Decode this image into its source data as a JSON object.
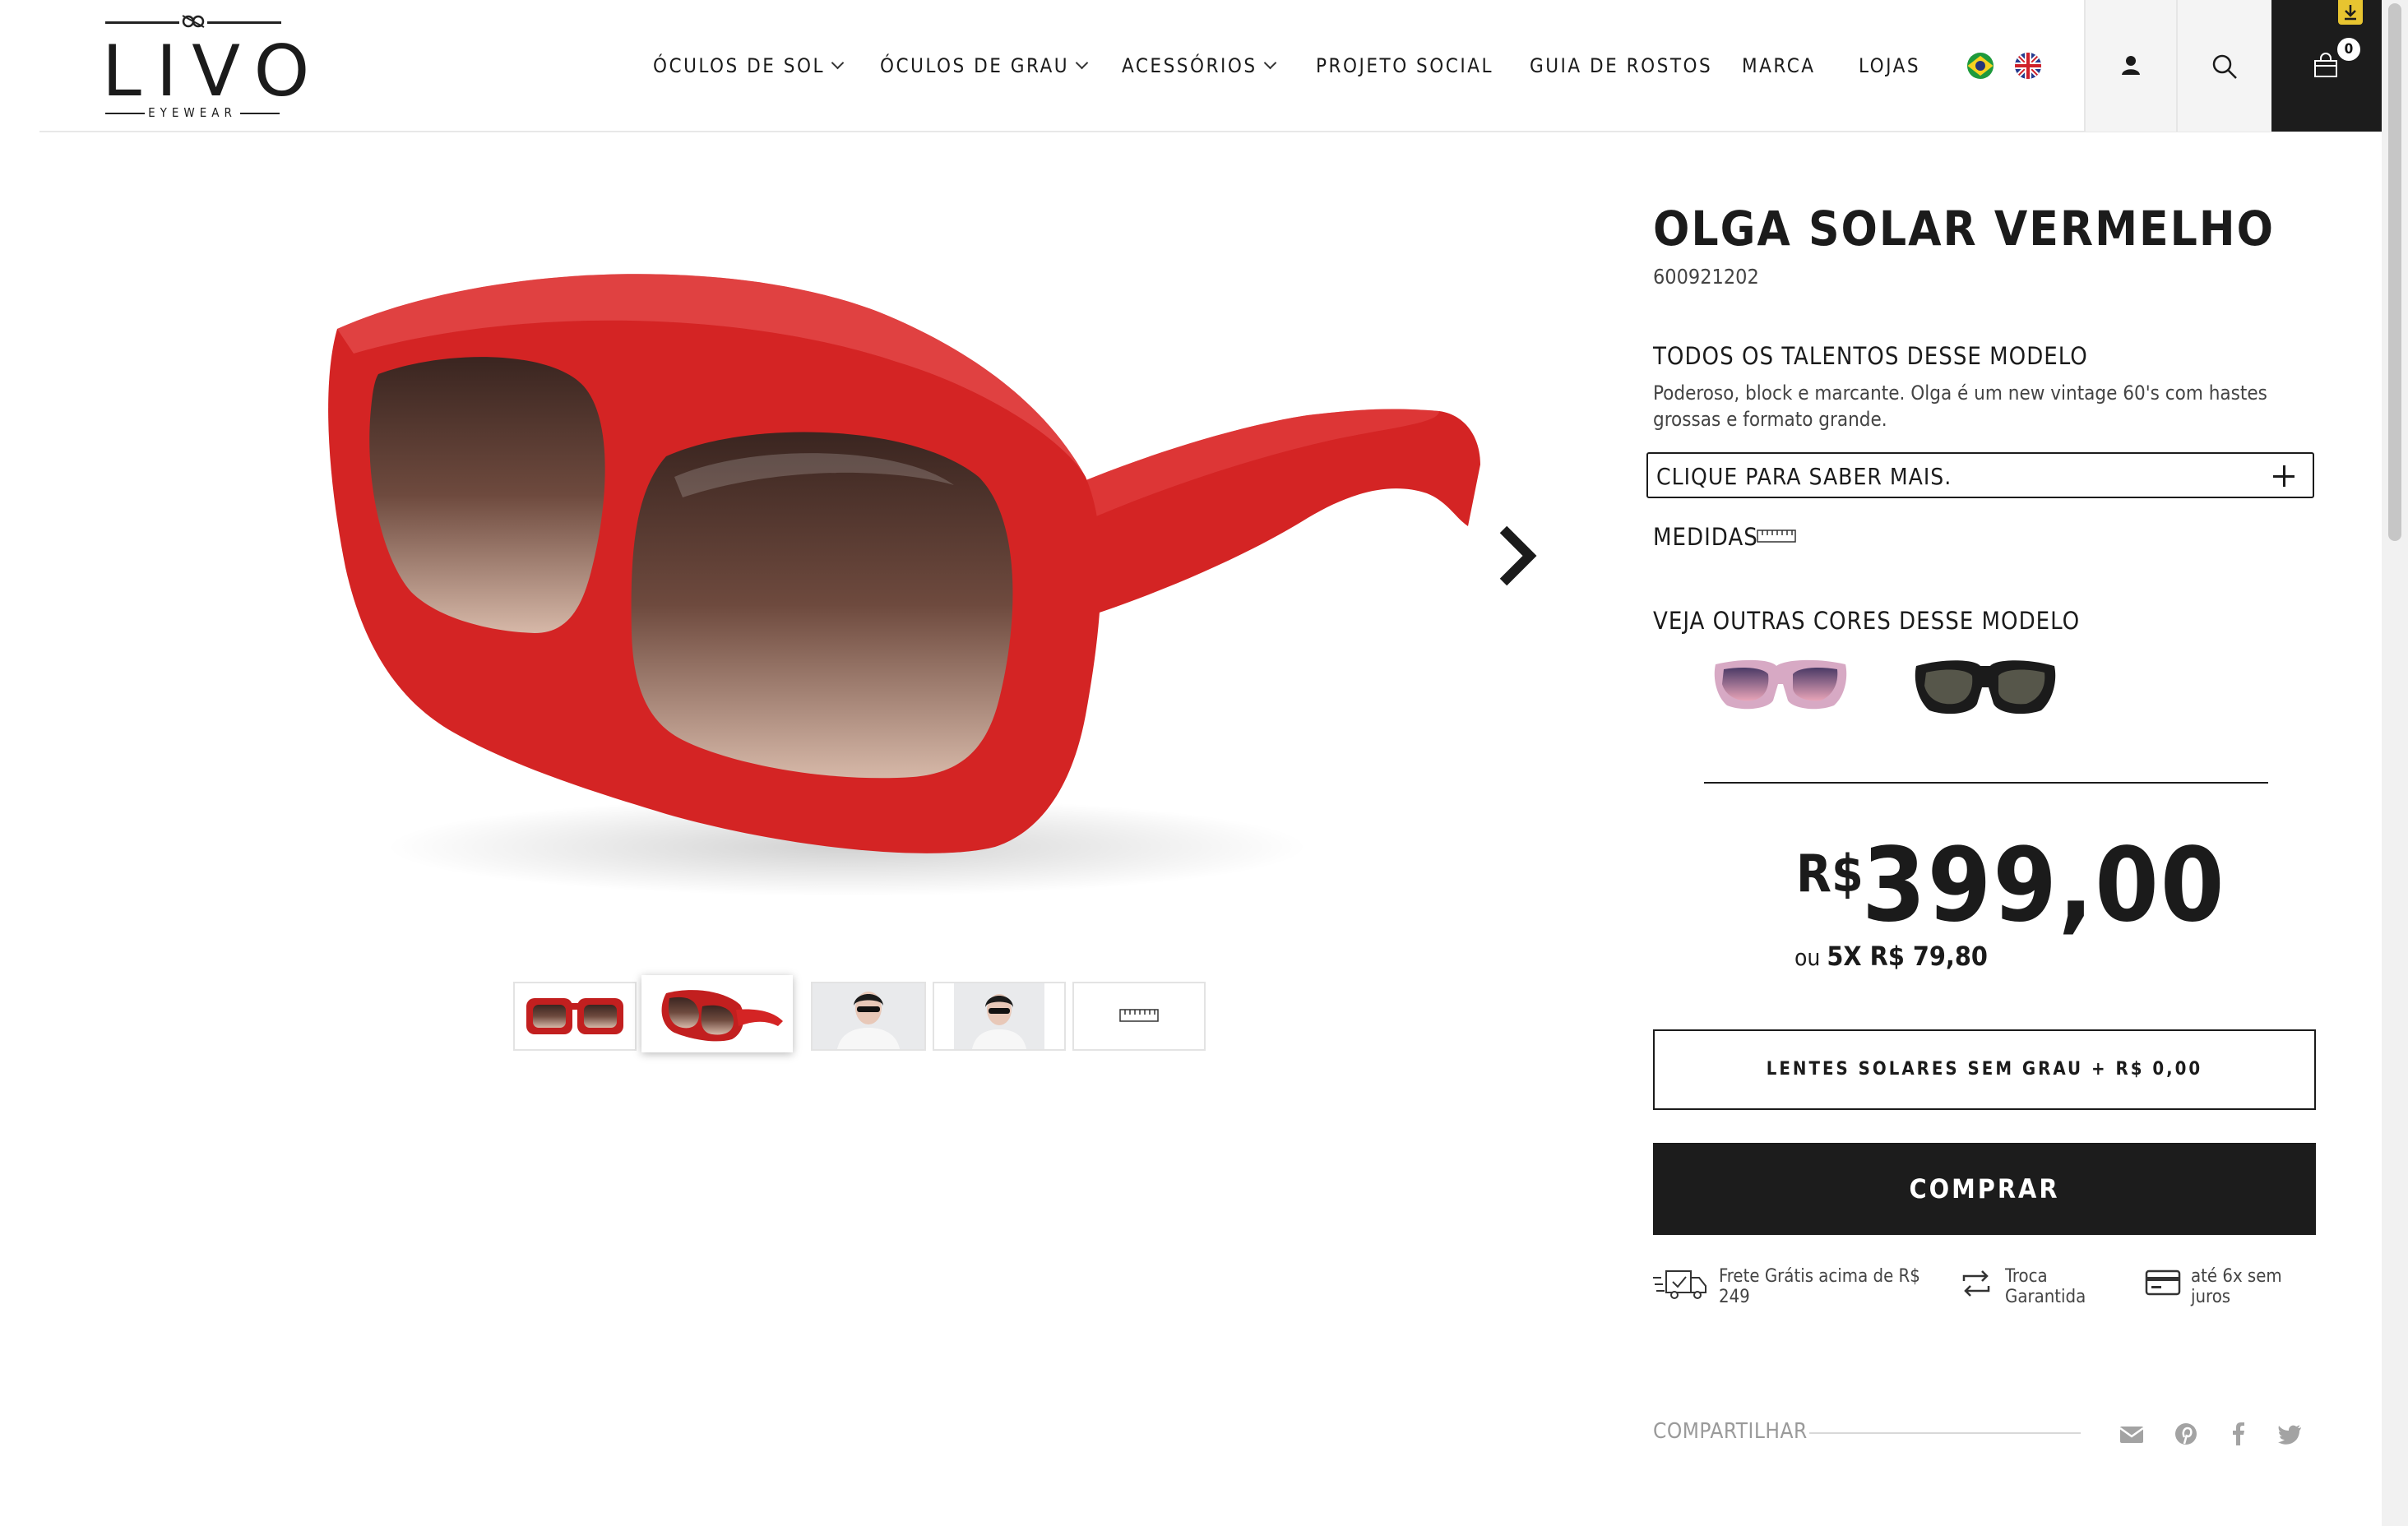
{
  "header": {
    "logo": {
      "brand": "LIVO",
      "tagline": "EYEWEAR"
    },
    "nav": [
      {
        "label": "ÓCULOS DE SOL",
        "has_dropdown": true
      },
      {
        "label": "ÓCULOS DE GRAU",
        "has_dropdown": true
      },
      {
        "label": "ACESSÓRIOS",
        "has_dropdown": true
      },
      {
        "label": "PROJETO SOCIAL",
        "has_dropdown": false
      },
      {
        "label": "GUIA DE ROSTOS",
        "has_dropdown": false
      },
      {
        "label": "MARCA",
        "has_dropdown": false
      },
      {
        "label": "LOJAS",
        "has_dropdown": false
      }
    ],
    "languages": [
      "brazil-flag-icon",
      "uk-flag-icon"
    ],
    "icons": {
      "account": "user-icon",
      "search": "search-icon",
      "cart": "shopping-bag-icon"
    },
    "cart_count": "0"
  },
  "gallery": {
    "main_image": "red-sunglasses-three-quarter-view",
    "thumbnails": [
      "red-sunglasses-front",
      "red-sunglasses-angle",
      "model-wearing-sunglasses-1",
      "model-wearing-sunglasses-2",
      "ruler-measurement"
    ],
    "active_thumbnail": 1
  },
  "product": {
    "title": "OLGA SOLAR VERMELHO",
    "sku": "600921202",
    "talents_heading": "TODOS OS TALENTOS DESSE MODELO",
    "description": "Poderoso, block e marcante. Olga é um new vintage 60's com hastes grossas e formato grande.",
    "learn_more": "CLIQUE PARA SABER MAIS.",
    "measures_label": "MEDIDAS",
    "colors_heading": "VEJA OUTRAS CORES DESSE MODELO",
    "other_colors": [
      "pink-purple-gradient",
      "black"
    ],
    "price_currency": "R$",
    "price_value": "399,00",
    "installment_prefix": "ou",
    "installment_value": "5X R$ 79,80",
    "lens_option": "LENTES SOLARES SEM GRAU + R$ 0,00",
    "buy_label": "COMPRAR",
    "benefits": [
      {
        "icon": "truck-icon",
        "line1": "Frete Grátis acima de R$",
        "line2": "249"
      },
      {
        "icon": "exchange-icon",
        "line1": "Troca",
        "line2": "Garantida"
      },
      {
        "icon": "credit-card-icon",
        "line1": "até 6x sem",
        "line2": "juros"
      }
    ],
    "share_label": "COMPARTILHAR",
    "share_icons": [
      "email-icon",
      "pinterest-icon",
      "facebook-icon",
      "twitter-icon"
    ]
  },
  "colors": {
    "frame_red": "#d42424",
    "dark": "#1c1c1c",
    "text_gray": "#444444"
  }
}
